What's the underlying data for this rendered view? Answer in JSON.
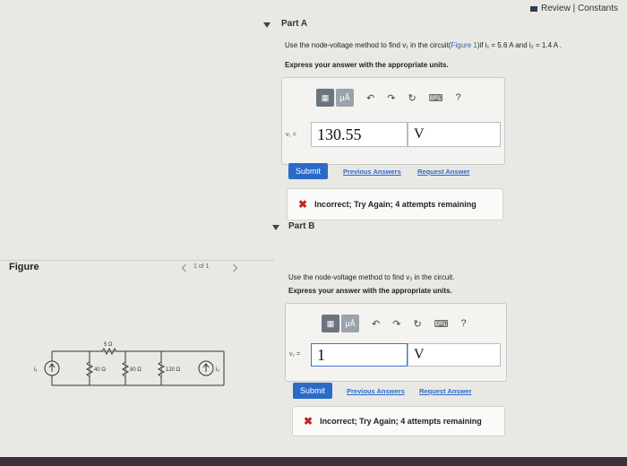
{
  "header": {
    "review_constants": "Review | Constants"
  },
  "figure_panel": {
    "title": "Figure",
    "pager": "1 of 1",
    "circuit": {
      "source_left": "i₁",
      "source_right": "i₂",
      "r_top": "5 Ω",
      "r1": "40 Ω",
      "r2": "80 Ω",
      "r3": "120 Ω"
    }
  },
  "part_a": {
    "title": "Part A",
    "instruction_pre": "Use the node-voltage method to find v₁ in the circuit(",
    "instruction_link": "Figure 1",
    "instruction_post": ")if i₁ = 5.6 A and i₂ = 1.4 A .",
    "express": "Express your answer with the appropriate units.",
    "var_label": "v₁ =",
    "value": "130.55",
    "unit": "V",
    "submit": "Submit",
    "previous_answers": "Previous Answers",
    "request_answer": "Request Answer",
    "feedback": "Incorrect; Try Again; 4 attempts remaining"
  },
  "part_b": {
    "title": "Part B",
    "instruction": "Use the node-voltage method to find v₂ in the circuit.",
    "express": "Express your answer with the appropriate units.",
    "var_label": "v₂ =",
    "value": "1",
    "unit": "V",
    "submit": "Submit",
    "previous_answers": "Previous Answers",
    "request_answer": "Request Answer",
    "feedback": "Incorrect; Try Again; 4 attempts remaining"
  },
  "toolbar": {
    "templates_icon": "templates-icon",
    "units_label": "μÅ",
    "undo_icon": "undo-icon",
    "redo_icon": "redo-icon",
    "reset_icon": "reset-icon",
    "keyboard_icon": "keyboard-icon",
    "help_label": "?"
  },
  "colors": {
    "submit": "#2c6ac8",
    "link": "#2c6ac8",
    "incorrect": "#c0271f",
    "toolbar_button": "#6b7580"
  }
}
